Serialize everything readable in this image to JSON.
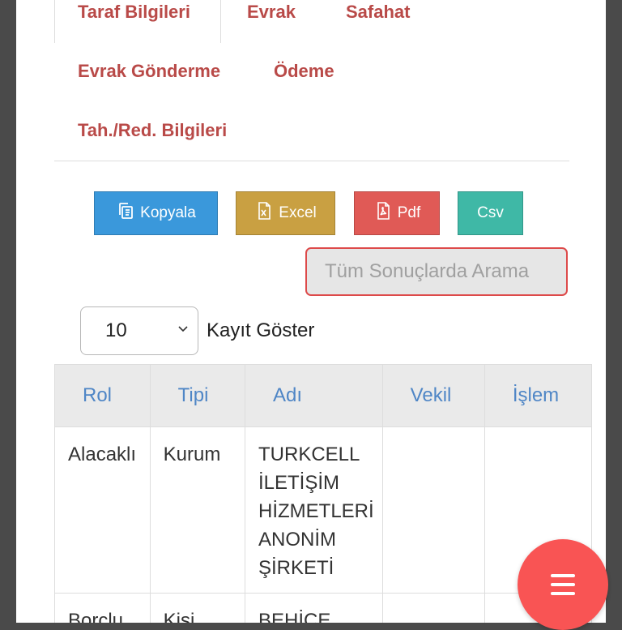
{
  "tabs": [
    {
      "label": "Taraf Bilgileri"
    },
    {
      "label": "Evrak"
    },
    {
      "label": "Safahat"
    },
    {
      "label": "Evrak Gönderme"
    },
    {
      "label": "Ödeme"
    },
    {
      "label": "Tah./Red. Bilgileri"
    }
  ],
  "buttons": {
    "copy": {
      "label": "Kopyala",
      "icon": "copy-icon",
      "color": "#3a98db"
    },
    "excel": {
      "label": "Excel",
      "icon": "excel-file-icon",
      "color": "#c9a042"
    },
    "pdf": {
      "label": "Pdf",
      "icon": "pdf-file-icon",
      "color": "#e05a56"
    },
    "csv": {
      "label": "Csv",
      "color": "#3fb8a6"
    }
  },
  "search": {
    "placeholder": "Tüm Sonuçlarda Arama"
  },
  "length": {
    "value": "10",
    "label": "Kayıt Göster"
  },
  "table": {
    "headers": [
      "Rol",
      "Tipi",
      "Adı",
      "Vekil",
      "İşlem"
    ],
    "rows": [
      {
        "rol": "Alacaklı",
        "tipi": "Kurum",
        "adi": "TURKCELL İLETİŞİM HİZMETLERİ ANONİM ŞİRKETİ",
        "vekil": "",
        "islem": ""
      },
      {
        "rol": "Borçlu",
        "tipi": "Kişi",
        "adi": "BEHİCE",
        "vekil": "",
        "islem": ""
      }
    ]
  },
  "fab": {
    "icon": "menu-icon",
    "color": "#f95454"
  }
}
